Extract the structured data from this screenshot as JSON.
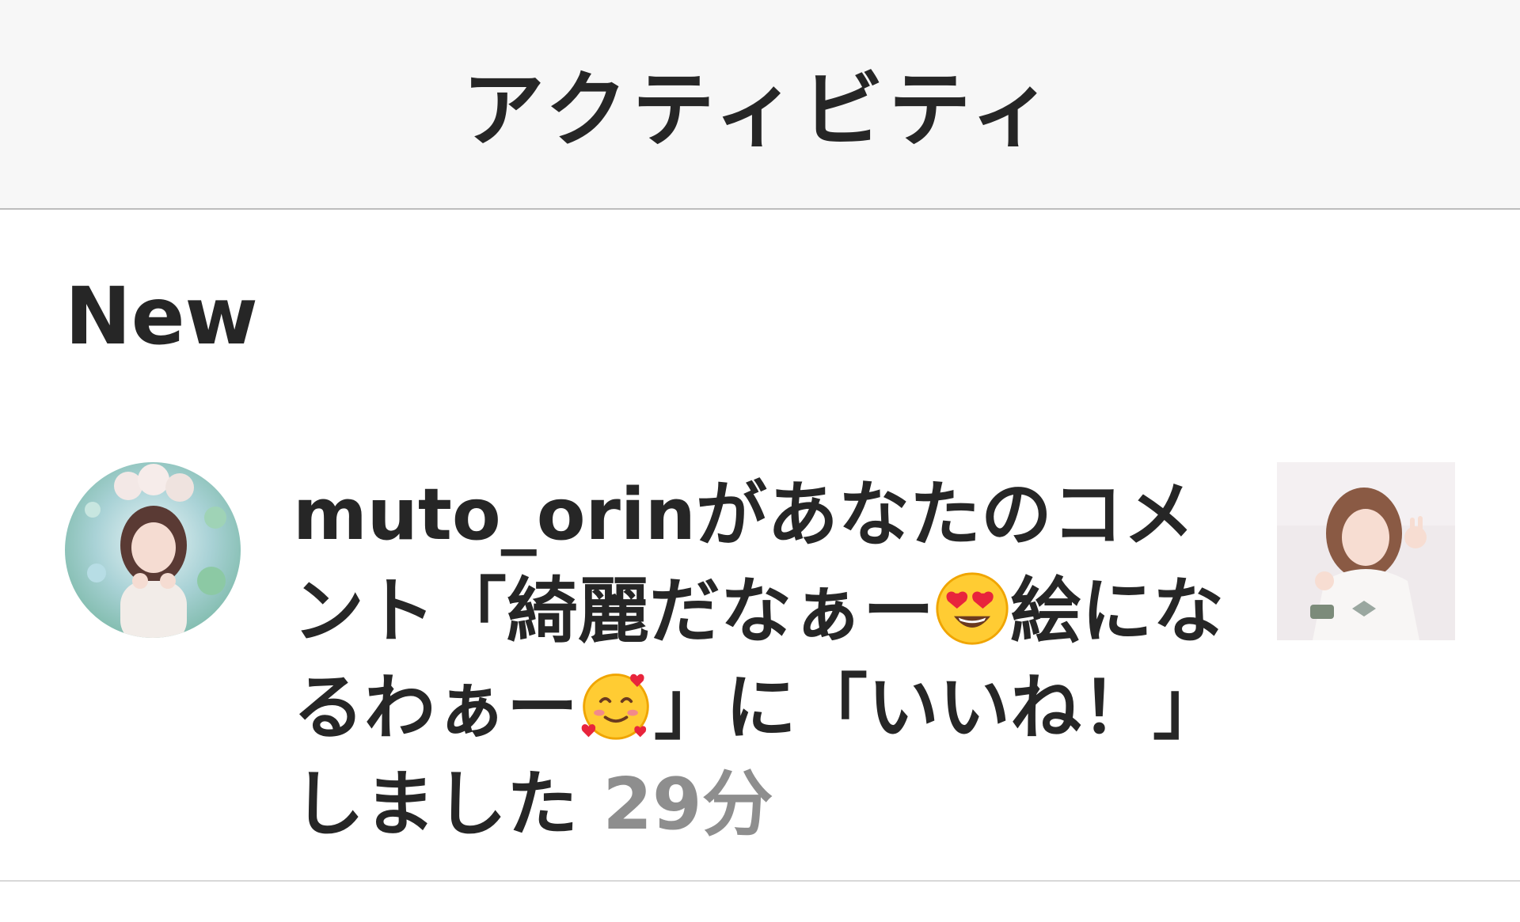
{
  "header": {
    "title": "アクティビティ"
  },
  "section": {
    "title": "New"
  },
  "notification": {
    "username": "muto_orin",
    "text_before_quote": "があなたのコメント「綺麗だなぁー",
    "emoji_1": "heart-eyes-emoji",
    "text_middle": "絵になるわぁー",
    "emoji_2": "smiling-face-with-hearts-emoji",
    "text_after": "」に「いいね！」しました",
    "time": "29分"
  },
  "colors": {
    "header_bg": "#f7f7f7",
    "text": "#262626",
    "secondary": "#8e8e8e"
  }
}
